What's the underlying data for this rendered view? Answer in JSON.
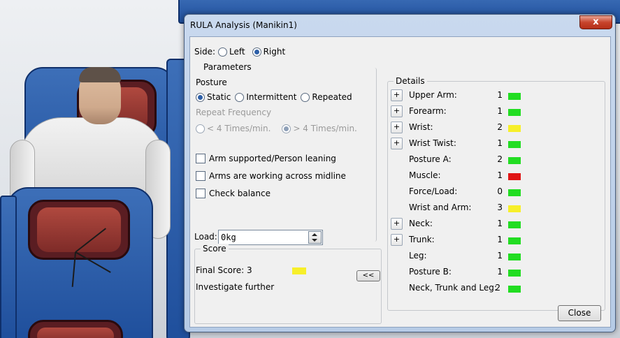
{
  "dialog": {
    "title": "RULA Analysis (Manikin1)",
    "close_glyph": "x",
    "side": {
      "label": "Side:",
      "options": [
        "Left",
        "Right"
      ],
      "selected": "Right"
    },
    "parameters": {
      "title": "Parameters",
      "posture_label": "Posture",
      "posture_options": [
        "Static",
        "Intermittent",
        "Repeated"
      ],
      "posture_selected": "Static",
      "repeat_label": "Repeat Frequency",
      "repeat_options": [
        "< 4 Times/min.",
        "> 4 Times/min."
      ],
      "repeat_selected": "> 4 Times/min.",
      "checkboxes": [
        "Arm supported/Person leaning",
        "Arms are working across midline",
        "Check balance"
      ],
      "load_label": "Load:",
      "load_value": "0kg"
    },
    "score": {
      "title": "Score",
      "final_label": "Final Score: 3",
      "final_color": "#f7ef2a",
      "verdict": "Investigate further",
      "collapse_label": "<<"
    },
    "details": {
      "title": "Details",
      "expand_label": "+",
      "items": [
        {
          "label": "Upper Arm:",
          "value": "1",
          "color": "#22dd22",
          "expandable": true
        },
        {
          "label": "Forearm:",
          "value": "1",
          "color": "#22dd22",
          "expandable": true
        },
        {
          "label": "Wrist:",
          "value": "2",
          "color": "#f7ef2a",
          "expandable": true
        },
        {
          "label": "Wrist Twist:",
          "value": "1",
          "color": "#22dd22",
          "expandable": true
        },
        {
          "label": "Posture A:",
          "value": "2",
          "color": "#22dd22",
          "expandable": false
        },
        {
          "label": "Muscle:",
          "value": "1",
          "color": "#e01515",
          "expandable": false
        },
        {
          "label": "Force/Load:",
          "value": "0",
          "color": "#22dd22",
          "expandable": false
        },
        {
          "label": "Wrist and Arm:",
          "value": "3",
          "color": "#f7ef2a",
          "expandable": false
        },
        {
          "label": "Neck:",
          "value": "1",
          "color": "#22dd22",
          "expandable": true
        },
        {
          "label": "Trunk:",
          "value": "1",
          "color": "#22dd22",
          "expandable": true
        },
        {
          "label": "Leg:",
          "value": "1",
          "color": "#22dd22",
          "expandable": false
        },
        {
          "label": "Posture B:",
          "value": "1",
          "color": "#22dd22",
          "expandable": false
        },
        {
          "label": "Neck, Trunk and Leg:",
          "value": "2",
          "color": "#22dd22",
          "expandable": false
        }
      ]
    },
    "close_button": "Close"
  }
}
